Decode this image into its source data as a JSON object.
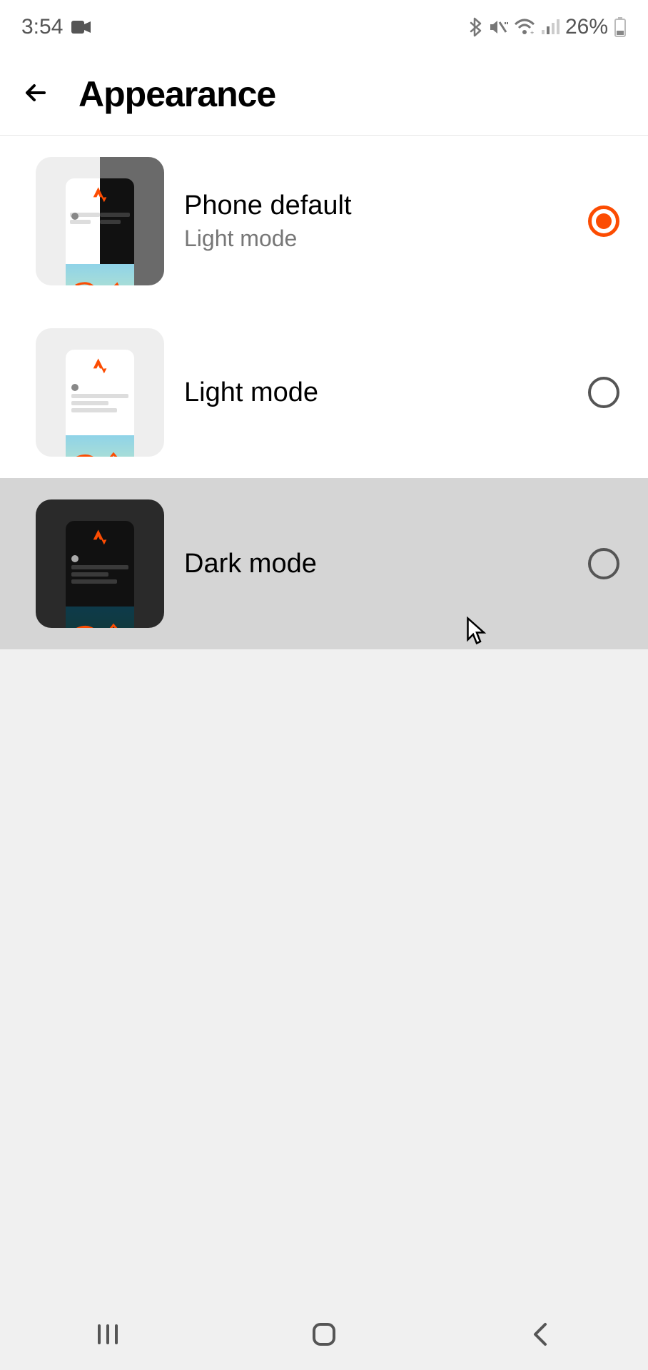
{
  "status": {
    "time": "3:54",
    "battery_pct": "26%"
  },
  "header": {
    "title": "Appearance"
  },
  "options": [
    {
      "id": "phone-default",
      "title": "Phone default",
      "subtitle": "Light mode",
      "selected": true
    },
    {
      "id": "light",
      "title": "Light mode",
      "subtitle": "",
      "selected": false
    },
    {
      "id": "dark",
      "title": "Dark mode",
      "subtitle": "",
      "selected": false,
      "highlight": true
    }
  ],
  "colors": {
    "accent": "#fc4c02"
  }
}
